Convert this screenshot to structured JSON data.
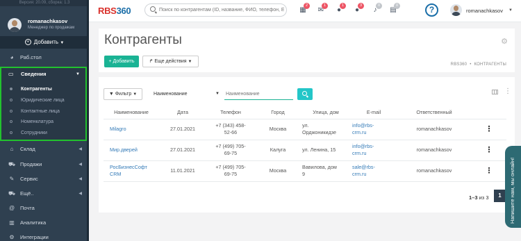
{
  "sidebar": {
    "version": "Версия: 20.09, сборка: 1.3",
    "user_name": "romanachkasov",
    "user_role": "Менеджер по продажам",
    "add_label": "Добавить",
    "items": [
      {
        "label": "Раб.стол",
        "icon": "pie-chart-icon"
      },
      {
        "label": "Склад",
        "icon": "warehouse-icon"
      },
      {
        "label": "Продажи",
        "icon": "cart-icon"
      },
      {
        "label": "Сервис",
        "icon": "wrench-icon"
      },
      {
        "label": "Ещё..",
        "icon": "cart-icon"
      },
      {
        "label": "Почта",
        "icon": "at-icon"
      },
      {
        "label": "Аналитика",
        "icon": "bar-chart-icon"
      },
      {
        "label": "Интеграции",
        "icon": "gear-icon"
      }
    ],
    "section": {
      "label": "Сведения",
      "icon": "id-card-icon",
      "highlight_color": "#22c22e",
      "items": [
        {
          "label": "Контрагенты",
          "current": true
        },
        {
          "label": "Юридические лица"
        },
        {
          "label": "Контактные лица"
        },
        {
          "label": "Номенклатура"
        },
        {
          "label": "Сотрудники"
        }
      ]
    }
  },
  "topbar": {
    "logo_text": "RBS",
    "logo_num": "360",
    "search_placeholder": "Поиск по контрагентам (ID, название, ФИО, телефон, E",
    "icons": [
      {
        "name": "calendar-icon",
        "badge": "2"
      },
      {
        "name": "envelope-icon",
        "badge": "1"
      },
      {
        "name": "chat-icon",
        "badge": "1"
      },
      {
        "name": "comments-icon",
        "badge": "3"
      },
      {
        "name": "bell-icon",
        "badge": "0"
      },
      {
        "name": "tasks-icon",
        "badge": "0"
      }
    ],
    "help": "?",
    "user_name": "romanachkasov"
  },
  "page": {
    "title": "Контрагенты",
    "add_button": "Добавить",
    "more_button": "Еще действия",
    "breadcrumbs": [
      "RBS360",
      "КОНТРАГЕНТЫ"
    ],
    "filter_button": "Фильтр",
    "filter_field": "Наименование",
    "filter_input_placeholder": "Наименование"
  },
  "table": {
    "columns": [
      "Наименование",
      "Дата",
      "Телефон",
      "Город",
      "Улица, дом",
      "E-mail",
      "Ответственный"
    ],
    "rows": [
      {
        "name": "Milagro",
        "date": "27.01.2021",
        "phone1": "+7 (343) 458-",
        "phone2": "52-66",
        "city": "Москва",
        "addr1": "ул.",
        "addr2": "Орджоникидзе",
        "mail1": "info@rbs-",
        "mail2": "crm.ru",
        "owner": "romanachkasov"
      },
      {
        "name": "Мир.дверей",
        "date": "27.01.2021",
        "phone1": "+7 (499) 705-",
        "phone2": "69-75",
        "city": "Калуга",
        "addr1": "ул. Ленина, 15",
        "addr2": "",
        "mail1": "info@rbs-",
        "mail2": "crm.ru",
        "owner": "romanachkasov"
      },
      {
        "name": "РосБизнесСофт",
        "name2": "CRM",
        "date": "11.01.2021",
        "phone1": "+7 (499) 705-",
        "phone2": "69-75",
        "city": "Москва",
        "addr1": "Вавилова, дом",
        "addr2": "9",
        "mail1": "sale@rbs-",
        "mail2": "crm.ru",
        "owner": "romanachkasov"
      }
    ]
  },
  "pagination": {
    "range": "1–3",
    "of_label": "из",
    "total": "3",
    "current_page": "1"
  },
  "chat": {
    "label": "Напишите нам, мы онлайн!"
  }
}
